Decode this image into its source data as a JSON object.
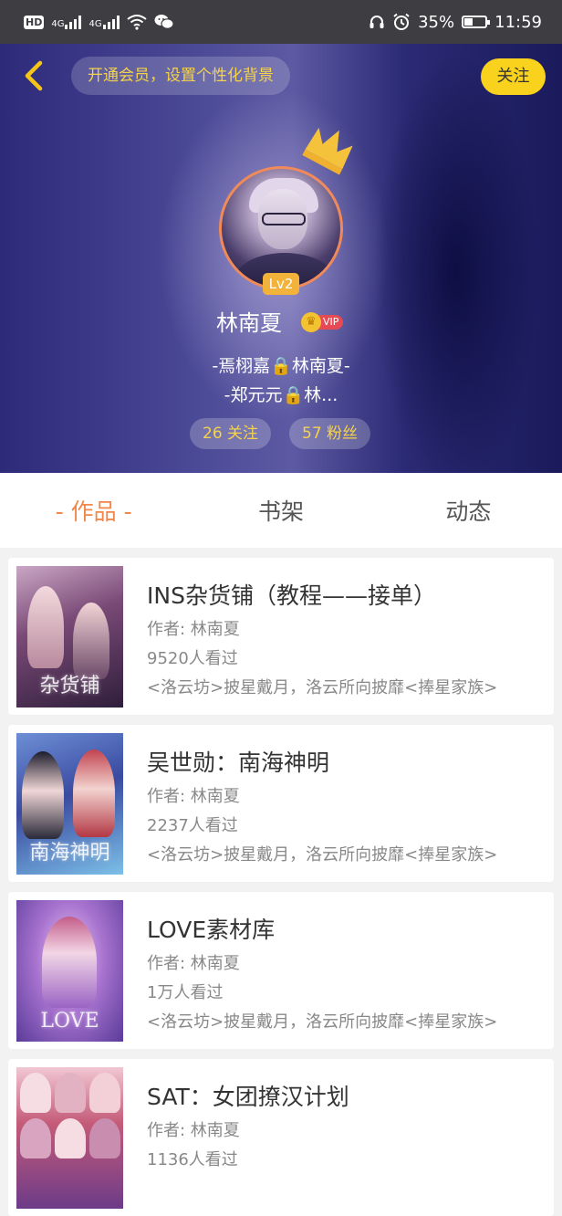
{
  "status_bar": {
    "hd": "HD",
    "net1": "4G",
    "net2": "4G",
    "battery": "35%",
    "time": "11:59",
    "icons": [
      "hd-icon",
      "signal-icon",
      "wifi-icon",
      "wechat-icon",
      "headset-icon",
      "alarm-icon",
      "battery-icon"
    ]
  },
  "header": {
    "back_icon": "chevron-left-icon",
    "vip_banner": "开通会员，设置个性化背景",
    "follow": "关注",
    "level": "Lv2",
    "name": "林南夏",
    "vip_label": "VIP",
    "signature_line1": "-焉栩嘉🔒林南夏-",
    "signature_line2": "-郑元元🔒林...",
    "following": "26 关注",
    "fans": "57 粉丝"
  },
  "tabs": [
    {
      "label": "- 作品 -",
      "active": true
    },
    {
      "label": "书架",
      "active": false
    },
    {
      "label": "动态",
      "active": false
    }
  ],
  "books": [
    {
      "title": "INS杂货铺（教程——接单）",
      "author": "作者: 林南夏",
      "views": "9520人看过",
      "desc": "<洛云坊>披星戴月，洛云所向披靡<捧星家族>",
      "cover_text": "杂货铺"
    },
    {
      "title": "吴世勋：南海神明",
      "author": "作者: 林南夏",
      "views": "2237人看过",
      "desc": "<洛云坊>披星戴月，洛云所向披靡<捧星家族>",
      "cover_text": "南海神明"
    },
    {
      "title": "LOVE素材库",
      "author": "作者: 林南夏",
      "views": "1万人看过",
      "desc": "<洛云坊>披星戴月，洛云所向披靡<捧星家族>",
      "cover_text": "LOVE"
    },
    {
      "title": "SAT：女团撩汉计划",
      "author": "作者: 林南夏",
      "views": "1136人看过",
      "desc": "",
      "cover_text": ""
    }
  ]
}
